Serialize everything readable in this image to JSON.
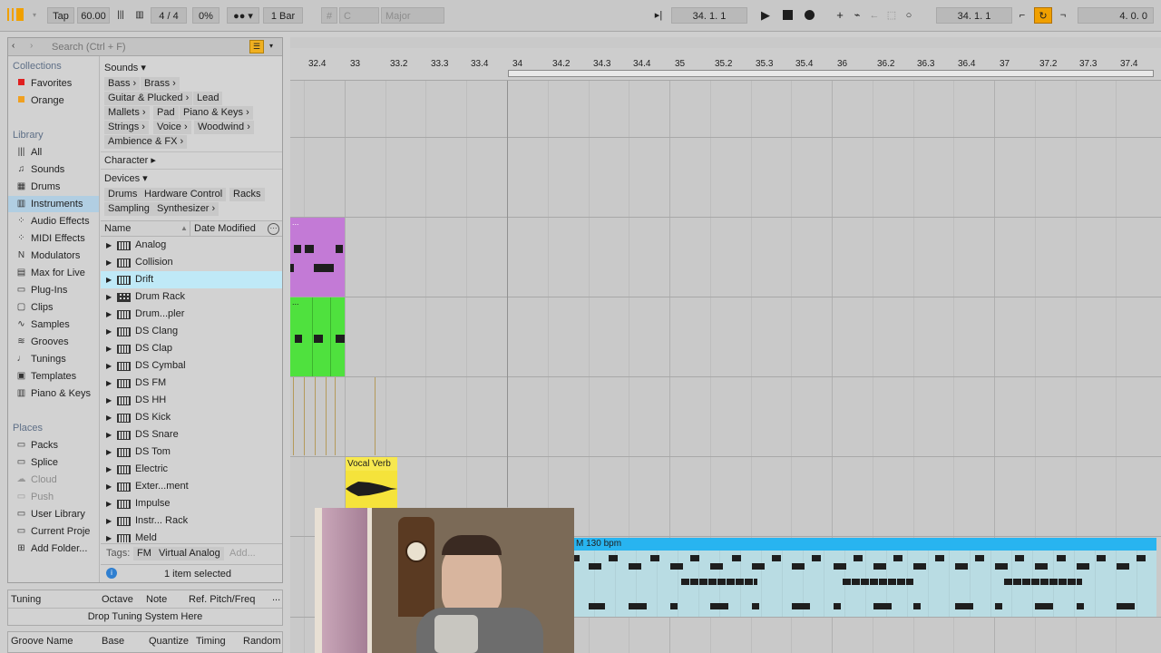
{
  "transport": {
    "tap": "Tap",
    "tempo": "60.00",
    "signature": "4 / 4",
    "cpu": "0%",
    "quantize": "1 Bar",
    "key": "C",
    "scale": "Major",
    "position": "34.  1.  1",
    "position2": "34.  1.  1",
    "loop_length": "4.  0.  0"
  },
  "browser": {
    "search_placeholder": "Search (Ctrl + F)",
    "collections_head": "Collections",
    "collections": [
      {
        "label": "Favorites",
        "color": "#e02020"
      },
      {
        "label": "Orange",
        "color": "#f0a020"
      }
    ],
    "library_head": "Library",
    "library": [
      {
        "label": "All",
        "icon": "bars-icon"
      },
      {
        "label": "Sounds",
        "icon": "note-icon"
      },
      {
        "label": "Drums",
        "icon": "drum-grid-icon"
      },
      {
        "label": "Instruments",
        "icon": "keyboard-icon"
      },
      {
        "label": "Audio Effects",
        "icon": "dots-icon"
      },
      {
        "label": "MIDI Effects",
        "icon": "dots-icon"
      },
      {
        "label": "Modulators",
        "icon": "wave-icon"
      },
      {
        "label": "Max for Live",
        "icon": "max-icon"
      },
      {
        "label": "Plug-Ins",
        "icon": "plug-icon"
      },
      {
        "label": "Clips",
        "icon": "clip-icon"
      },
      {
        "label": "Samples",
        "icon": "wave-icon"
      },
      {
        "label": "Grooves",
        "icon": "groove-icon"
      },
      {
        "label": "Tunings",
        "icon": "tuning-icon"
      },
      {
        "label": "Templates",
        "icon": "template-icon"
      },
      {
        "label": "Piano & Keys",
        "icon": "keyboard-icon"
      }
    ],
    "places_head": "Places",
    "places": [
      {
        "label": "Packs",
        "muted": false
      },
      {
        "label": "Splice",
        "muted": false
      },
      {
        "label": "Cloud",
        "muted": true
      },
      {
        "label": "Push",
        "muted": true
      },
      {
        "label": "User Library",
        "muted": false
      },
      {
        "label": "Current Proje",
        "muted": false
      },
      {
        "label": "Add Folder...",
        "muted": false
      }
    ],
    "filters": {
      "sounds_head": "Sounds ▾",
      "sound_chips": [
        [
          "Bass ›",
          "Brass ›"
        ],
        [
          "Guitar & Plucked ›",
          "Lead"
        ],
        [
          "Mallets ›",
          "Pad",
          "Piano & Keys ›"
        ],
        [
          "Strings ›",
          "Voice ›",
          "Woodwind ›"
        ],
        [
          "Ambience & FX ›"
        ]
      ],
      "character_head": "Character ▸",
      "devices_head": "Devices ▾",
      "device_chips": [
        [
          "Drums",
          "Hardware Control",
          "Racks"
        ],
        [
          "Sampling",
          "Synthesizer ›"
        ]
      ]
    },
    "list": {
      "col_name": "Name",
      "col_date": "Date Modified",
      "items": [
        "Analog",
        "Collision",
        "Drift",
        "Drum Rack",
        "Drum...pler",
        "DS Clang",
        "DS Clap",
        "DS Cymbal",
        "DS FM",
        "DS HH",
        "DS Kick",
        "DS Snare",
        "DS Tom",
        "Electric",
        "Exter...ment",
        "Impulse",
        "Instr... Rack",
        "Meld"
      ],
      "selected": "Drift"
    },
    "tags_label": "Tags:",
    "tags": [
      "FM",
      "Virtual Analog",
      "Add..."
    ],
    "status": "1 item selected"
  },
  "tuning": {
    "head": "Tuning",
    "cols": [
      "Octave",
      "Note",
      "Ref. Pitch/Freq"
    ],
    "drop": "Drop Tuning System Here"
  },
  "groove": {
    "cols": [
      "Groove Name",
      "Base",
      "Quantize",
      "Timing",
      "Random"
    ]
  },
  "ruler": {
    "ticks": [
      "32.4",
      "33",
      "33.2",
      "33.3",
      "33.4",
      "34",
      "34.2",
      "34.3",
      "34.4",
      "35",
      "35.2",
      "35.3",
      "35.4",
      "36",
      "36.2",
      "36.3",
      "36.4",
      "37",
      "37.2",
      "37.3",
      "37.4"
    ]
  },
  "clips": {
    "audio_clip": "Vocal Verb",
    "midi_clip": "M 130 bpm",
    "dots": "..."
  },
  "colors": {
    "purple_clip": "#c37ad6",
    "green_clip": "#4fe13e",
    "yellow_clip": "#f5e33b",
    "blue_header": "#28b4f0",
    "blue_body": "#b9dce3"
  }
}
